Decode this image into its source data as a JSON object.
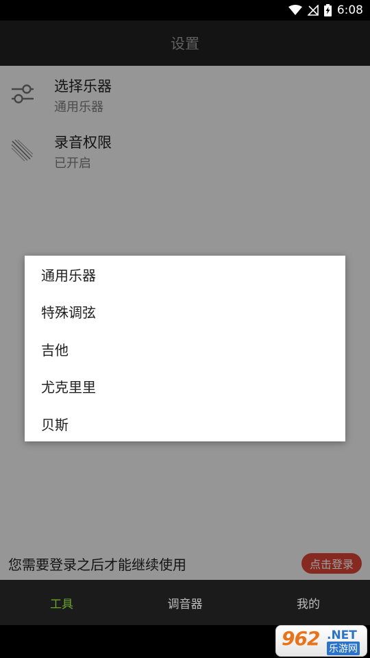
{
  "status_bar": {
    "time": "6:08"
  },
  "app_bar": {
    "title": "设置"
  },
  "settings": [
    {
      "title": "选择乐器",
      "subtitle": "通用乐器",
      "icon": "sliders-icon"
    },
    {
      "title": "录音权限",
      "subtitle": "已开启",
      "icon": "microphone-icon"
    }
  ],
  "dialog": {
    "options": [
      "通用乐器",
      "特殊调弦",
      "吉他",
      "尤克里里",
      "贝斯"
    ]
  },
  "login_banner": {
    "text": "您需要登录之后才能继续使用",
    "button": "点击登录"
  },
  "bottom_nav": {
    "items": [
      {
        "label": "工具",
        "active": true
      },
      {
        "label": "调音器",
        "active": false
      },
      {
        "label": "我的",
        "active": false
      }
    ]
  },
  "watermark": {
    "number": "962",
    "net": ".NET",
    "site": "乐游网"
  },
  "colors": {
    "accent_green": "#6aa52c",
    "login_red": "#d84436",
    "watermark_orange": "#e8731a",
    "watermark_blue": "#2a73c9"
  }
}
